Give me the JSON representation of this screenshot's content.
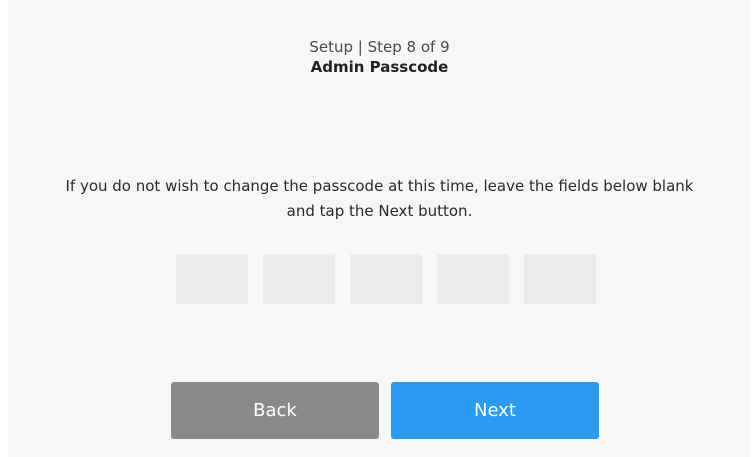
{
  "header": {
    "step": "Setup | Step 8 of 9",
    "title": "Admin Passcode"
  },
  "instructions": {
    "line1": "If you do not wish to change the passcode at this time, leave the fields below blank",
    "line2": "and tap the Next button."
  },
  "passcode_fields": [
    {
      "value": ""
    },
    {
      "value": ""
    },
    {
      "value": ""
    },
    {
      "value": ""
    },
    {
      "value": ""
    }
  ],
  "buttons": {
    "back_label": "Back",
    "next_label": "Next"
  },
  "colors": {
    "background": "#f7f7f7",
    "field": "#ececec",
    "back_button": "#8a8a8a",
    "next_button": "#2b9af3"
  }
}
